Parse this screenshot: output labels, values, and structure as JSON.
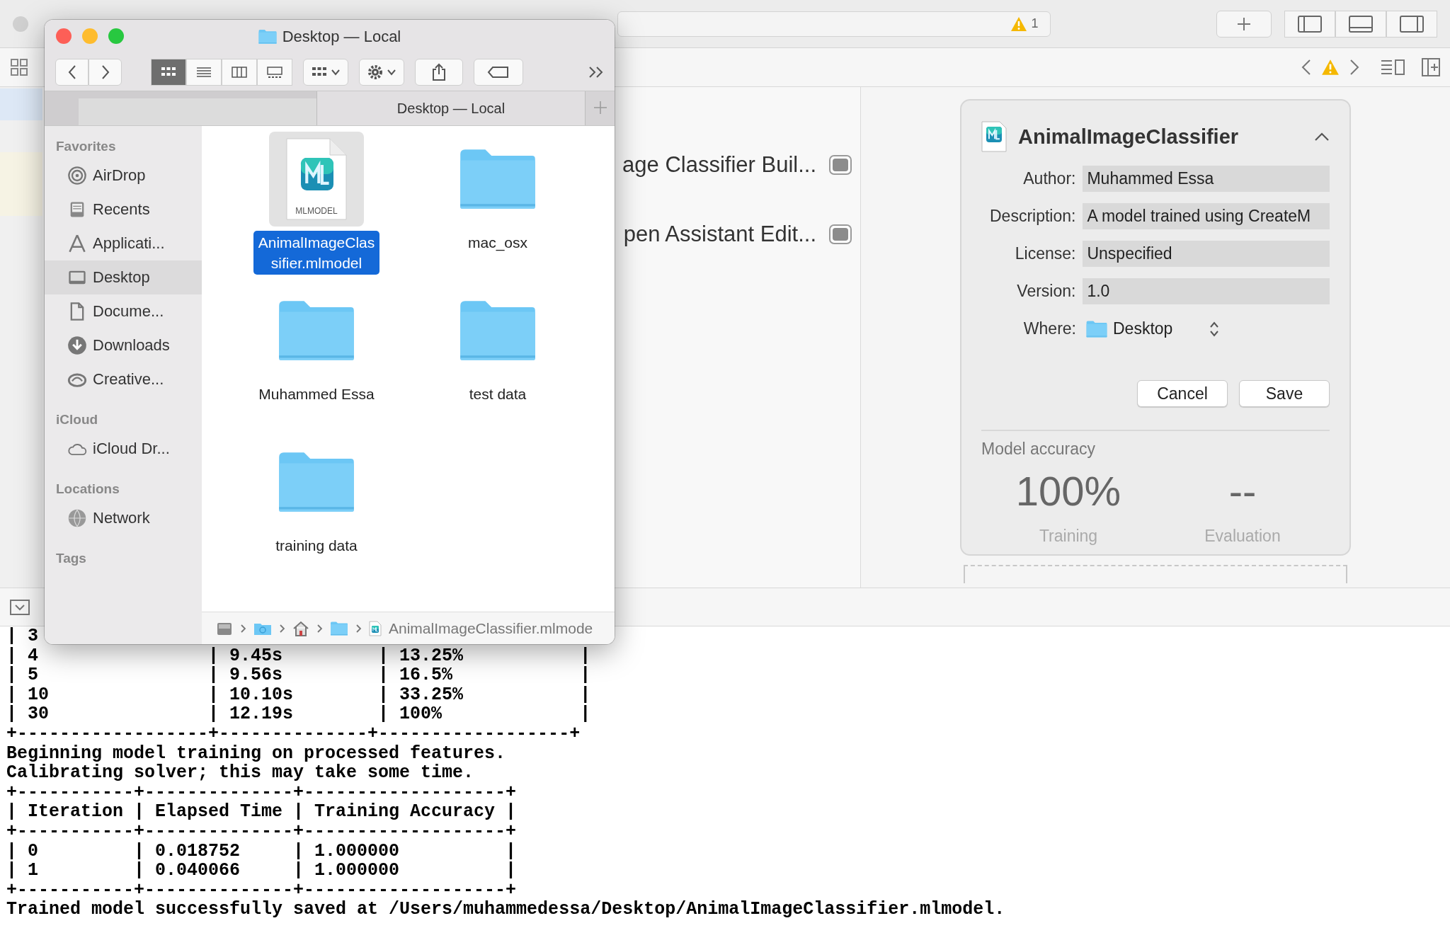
{
  "xcode": {
    "activity": {
      "warning_count": "1"
    },
    "editor_rows": [
      {
        "label": "age Classifier Buil..."
      },
      {
        "label": "pen Assistant Edit..."
      }
    ],
    "model_card": {
      "title": "AnimalImageClassifier",
      "fields": [
        {
          "label": "Author:",
          "value": "Muhammed Essa"
        },
        {
          "label": "Description:",
          "value": "A model trained using CreateM"
        },
        {
          "label": "License:",
          "value": "Unspecified"
        },
        {
          "label": "Version:",
          "value": "1.0"
        }
      ],
      "where": {
        "label": "Where:",
        "value": "Desktop"
      },
      "buttons": [
        "Cancel",
        "Save"
      ],
      "accuracy": {
        "title": "Model accuracy",
        "metrics": [
          {
            "value": "100%",
            "label": "Training"
          },
          {
            "value": "--",
            "label": "Evaluation"
          }
        ]
      }
    },
    "console": {
      "lines": [
        "| 3",
        "| 4                | 9.45s         | 13.25%           |",
        "| 5                | 9.56s         | 16.5%            |",
        "| 10               | 10.10s        | 33.25%           |",
        "| 30               | 12.19s        | 100%             |",
        "+------------------+--------------+------------------+",
        "Beginning model training on processed features.",
        "Calibrating solver; this may take some time.",
        "+-----------+--------------+-------------------+",
        "| Iteration | Elapsed Time | Training Accuracy |",
        "+-----------+--------------+-------------------+",
        "| 0         | 0.018752     | 1.000000          |",
        "| 1         | 0.040066     | 1.000000          |",
        "+-----------+--------------+-------------------+",
        "Trained model successfully saved at /Users/muhammedessa/Desktop/AnimalImageClassifier.mlmodel."
      ]
    }
  },
  "finder": {
    "title": "Desktop — Local",
    "view_modes": [
      {
        "selected": true
      },
      {
        "selected": false
      },
      {
        "selected": false
      },
      {
        "selected": false
      }
    ],
    "tab": {
      "label": "Desktop — Local"
    },
    "sidebar": [
      {
        "title": "Favorites",
        "items": [
          {
            "label": "AirDrop",
            "selected": false
          },
          {
            "label": "Recents",
            "selected": false
          },
          {
            "label": "Applicati...",
            "selected": false
          },
          {
            "label": "Desktop",
            "selected": true
          },
          {
            "label": "Docume...",
            "selected": false
          },
          {
            "label": "Downloads",
            "selected": false
          },
          {
            "label": "Creative...",
            "selected": false
          }
        ]
      },
      {
        "title": "iCloud",
        "items": [
          {
            "label": "iCloud Dr...",
            "selected": false
          }
        ]
      },
      {
        "title": "Locations",
        "items": [
          {
            "label": "Network",
            "selected": false
          }
        ]
      },
      {
        "title": "Tags"
      }
    ],
    "files": [
      {
        "kind": "mlmodel",
        "name": "AnimalImageClassifier.mlmodel",
        "badge": "MLMODEL",
        "selected": true
      },
      {
        "kind": "folder",
        "name": "mac_osx",
        "selected": false
      },
      {
        "kind": "folder",
        "name": "Muhammed Essa",
        "selected": false
      },
      {
        "kind": "folder",
        "name": "test data",
        "selected": false
      },
      {
        "kind": "folder",
        "name": "training data",
        "selected": false
      }
    ],
    "path_bar": {
      "file": "AnimalImageClassifier.mlmode"
    }
  }
}
